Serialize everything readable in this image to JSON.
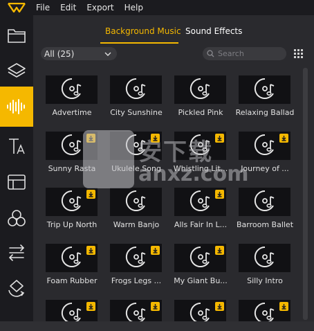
{
  "menu": {
    "items": [
      "File",
      "Edit",
      "Export",
      "Help"
    ]
  },
  "sidebar": {
    "items": [
      {
        "icon": "folder-icon",
        "active": false
      },
      {
        "icon": "layers-icon",
        "active": false
      },
      {
        "icon": "audio-waveform-icon",
        "active": true
      },
      {
        "icon": "text-icon",
        "active": false
      },
      {
        "icon": "transition-icon",
        "active": false
      },
      {
        "icon": "effects-icon",
        "active": false
      },
      {
        "icon": "split-arrows-icon",
        "active": false
      },
      {
        "icon": "crop-rotate-icon",
        "active": false
      }
    ]
  },
  "tabs": [
    {
      "label": "Background Music",
      "active": true
    },
    {
      "label": "Sound Effects",
      "active": false
    }
  ],
  "filter": {
    "value": "All (25)"
  },
  "search": {
    "placeholder": "Search"
  },
  "tracks": [
    {
      "title": "Advertime",
      "download": false
    },
    {
      "title": "City Sunshine",
      "download": false
    },
    {
      "title": "Pickled Pink",
      "download": false
    },
    {
      "title": "Relaxing Ballad",
      "download": false
    },
    {
      "title": "Sunny Rasta",
      "download": true
    },
    {
      "title": "Ukulele Song",
      "download": true
    },
    {
      "title": "Whistling Lit...",
      "download": true
    },
    {
      "title": "Journey of ...",
      "download": true
    },
    {
      "title": "Trip Up North",
      "download": true
    },
    {
      "title": "Warm Banjo",
      "download": false
    },
    {
      "title": "Alls Fair In L...",
      "download": true
    },
    {
      "title": "Barroom Ballet",
      "download": false
    },
    {
      "title": "Foam Rubber",
      "download": true
    },
    {
      "title": "Frogs Legs ...",
      "download": true
    },
    {
      "title": "My Giant Bu...",
      "download": true
    },
    {
      "title": "Silly Intro",
      "download": false
    },
    {
      "title": "",
      "download": true
    },
    {
      "title": "",
      "download": true
    },
    {
      "title": "",
      "download": true
    },
    {
      "title": "",
      "download": true
    }
  ],
  "watermark": {
    "text": "安下载",
    "sub": "anxz.com"
  },
  "colors": {
    "accent": "#f5b800",
    "panel": "#2a2a2e",
    "sidebar": "#1b1b1f",
    "thumb": "#111114"
  }
}
